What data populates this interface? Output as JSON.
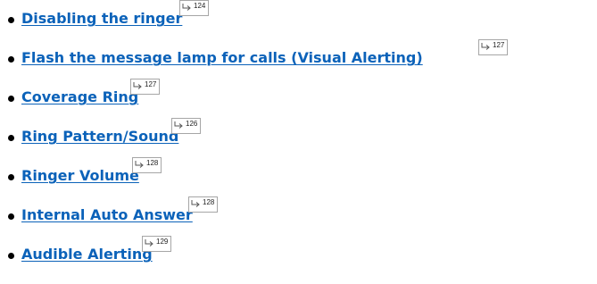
{
  "links": [
    {
      "label": "Disabling the ringer",
      "page": "124"
    },
    {
      "label": "Flash the message lamp for calls (Visual Alerting)",
      "page": "127"
    },
    {
      "label": "Coverage Ring",
      "page": "127"
    },
    {
      "label": "Ring Pattern/Sound",
      "page": "126"
    },
    {
      "label": "Ringer Volume",
      "page": "128"
    },
    {
      "label": "Internal Auto Answer",
      "page": "128"
    },
    {
      "label": "Audible Alerting",
      "page": "129"
    }
  ],
  "colors": {
    "link": "#0b62b9",
    "bullet": "#000000",
    "ref_border": "#a6a6a6"
  },
  "icons": {
    "page_ref": "page-reference-arrow-icon",
    "bullet": "bullet-dot-icon"
  }
}
